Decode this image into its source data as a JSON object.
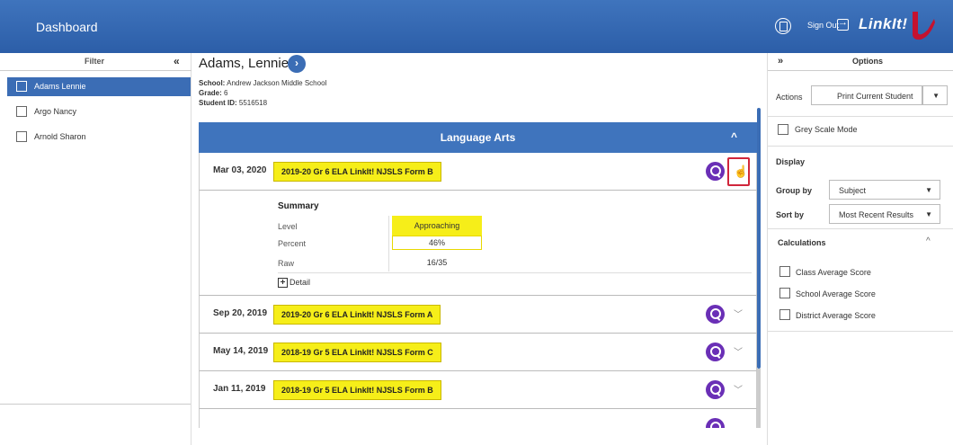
{
  "header": {
    "title": "Dashboard",
    "signout_label": "Sign Out",
    "logo_text": "LinkIt!",
    "brand_color": "#2c5ea8",
    "logo_accent": "#c4122f"
  },
  "filter": {
    "title": "Filter",
    "collapse": "«",
    "students": [
      {
        "name": "Adams Lennie",
        "selected": true
      },
      {
        "name": "Argo Nancy",
        "selected": false
      },
      {
        "name": "Arnold Sharon",
        "selected": false
      }
    ]
  },
  "student": {
    "name": "Adams, Lennie",
    "next": "›",
    "school_label": "School:",
    "school": "Andrew Jackson Middle School",
    "grade_label": "Grade:",
    "grade": "6",
    "id_label": "Student ID:",
    "id": "5516518"
  },
  "subject": {
    "name": "Language Arts",
    "caret": "^",
    "results": [
      {
        "date": "Mar 03, 2020",
        "test": "2019-20 Gr 6 ELA LinkIt! NJSLS Form B",
        "expanded": true
      },
      {
        "date": "Sep 20, 2019",
        "test": "2019-20 Gr 6 ELA LinkIt! NJSLS Form A",
        "expanded": false
      },
      {
        "date": "May 14, 2019",
        "test": "2018-19 Gr 5 ELA LinkIt! NJSLS Form C",
        "expanded": false
      },
      {
        "date": "Jan 11, 2019",
        "test": "2018-19 Gr 5 ELA LinkIt! NJSLS Form B",
        "expanded": false
      }
    ],
    "summary": {
      "title": "Summary",
      "level_label": "Level",
      "level": "Approaching",
      "percent_label": "Percent",
      "percent": "46%",
      "raw_label": "Raw",
      "raw": "16/35",
      "detail_label": "Detail",
      "detail_icon": "+"
    },
    "level_color": "#f6ee19",
    "search_color": "#6a2fb6"
  },
  "options": {
    "expand": "»",
    "title": "Options",
    "actions_label": "Actions",
    "actions_value": "Print Current Student",
    "grey_scale_label": "Grey Scale Mode",
    "display_label": "Display",
    "group_by_label": "Group by",
    "group_by_value": "Subject",
    "sort_by_label": "Sort by",
    "sort_by_value": "Most Recent Results",
    "calculations_label": "Calculations",
    "calc_caret": "^",
    "calc_items": [
      "Class Average Score",
      "School Average Score",
      "District Average Score"
    ]
  }
}
